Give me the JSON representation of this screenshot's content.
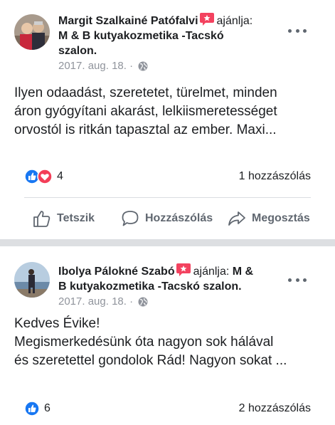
{
  "posts": [
    {
      "author": "Margit Szalkainé Patófalvi",
      "recommends_label": "ajánlja:",
      "page_name_line1": "M & B kutyakozmetika -Tacskó",
      "page_name_line2": "szalon.",
      "date": "2017. aug. 18.",
      "separator": "·",
      "body_lines": [
        "Ilyen odaadást, szeretetet, türelmet, minden",
        "áron gyógyítani akarást, lelkiismeretességet",
        "orvostól is ritkán tapasztal az ember. Maxi..."
      ],
      "reaction_count": "4",
      "comment_count": "1 hozzászólás",
      "reactions": [
        "like-icon",
        "love-icon"
      ]
    },
    {
      "author": "Ibolya Pálokné Szabó",
      "recommends_label": "ajánlja:",
      "page_name_line1": "M &",
      "page_name_line2": "B kutyakozmetika -Tacskó szalon.",
      "date": "2017. aug. 18.",
      "separator": "·",
      "body_lines": [
        "Kedves Évike!",
        "Megismerkedésünk óta nagyon sok hálával",
        "és szeretettel gondolok Rád! Nagyon sokat ..."
      ],
      "reaction_count": "6",
      "comment_count": "2 hozzászólás",
      "reactions": [
        "like-icon"
      ]
    }
  ],
  "actions": {
    "like": "Tetszik",
    "comment": "Hozzászólás",
    "share": "Megosztás"
  },
  "colors": {
    "like_blue": "#1877f2",
    "love_red": "#f33e58",
    "recommend_red": "#f3425f",
    "meta_gray": "#90949c",
    "action_gray": "#606770",
    "divider": "#dddfe2"
  }
}
